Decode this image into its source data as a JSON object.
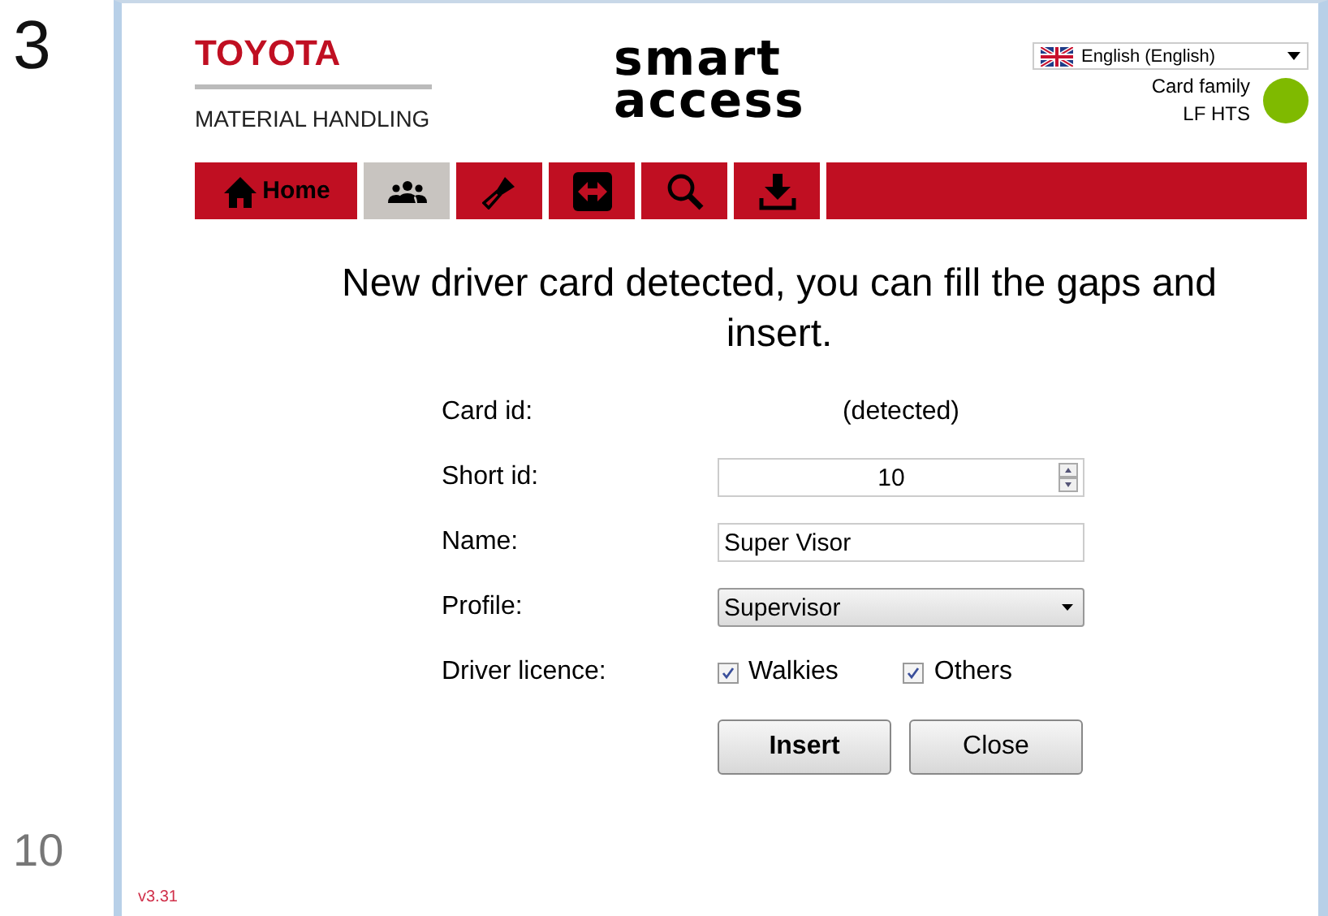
{
  "page_numbers": [
    "3",
    "10"
  ],
  "header": {
    "brand": "TOYOTA",
    "division": "MATERIAL HANDLING",
    "product_line1": "smart",
    "product_line2": "access",
    "language": "English (English)",
    "card_family_label": "Card family",
    "card_family_value": "LF HTS",
    "status_dot": {
      "color": "#7fba00"
    }
  },
  "nav": [
    {
      "kind": "home",
      "label": "Home",
      "selected": false
    },
    {
      "kind": "people",
      "selected": true
    },
    {
      "kind": "flashlight",
      "selected": false
    },
    {
      "kind": "arrows",
      "selected": false
    },
    {
      "kind": "search",
      "selected": false
    },
    {
      "kind": "download",
      "selected": false
    }
  ],
  "message": "New driver card detected, you can fill the gaps and insert.",
  "form": [
    {
      "kind": "static",
      "label": "Card id:",
      "value": "(detected)"
    },
    {
      "kind": "spinner",
      "label": "Short id:",
      "value": "10"
    },
    {
      "kind": "text",
      "label": "Name:",
      "value": "Super Visor"
    },
    {
      "kind": "select",
      "label": "Profile:",
      "value": "Supervisor"
    },
    {
      "kind": "checks",
      "label": "Driver licence:",
      "options": [
        {
          "label": "Walkies",
          "checked": true
        },
        {
          "label": "Others",
          "checked": true
        }
      ]
    }
  ],
  "buttons": [
    {
      "label": "Insert",
      "default": true
    },
    {
      "label": "Close",
      "default": false
    }
  ],
  "version": "v3.31"
}
